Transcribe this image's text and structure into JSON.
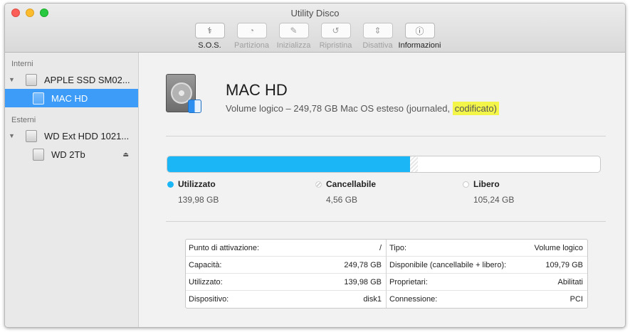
{
  "window": {
    "title": "Utility Disco"
  },
  "toolbar": {
    "items": [
      {
        "label": "S.O.S.",
        "icon": "stethoscope-icon",
        "glyph": "⚕",
        "enabled": true
      },
      {
        "label": "Partiziona",
        "icon": "partition-pie-icon",
        "glyph": "◔",
        "enabled": false
      },
      {
        "label": "Inizializza",
        "icon": "erase-icon",
        "glyph": "✎",
        "enabled": false
      },
      {
        "label": "Ripristina",
        "icon": "restore-icon",
        "glyph": "↺",
        "enabled": false
      },
      {
        "label": "Disattiva",
        "icon": "unmount-icon",
        "glyph": "⇕",
        "enabled": false
      },
      {
        "label": "Informazioni",
        "icon": "info-icon",
        "glyph": "ⓘ",
        "enabled": true
      }
    ]
  },
  "sidebar": {
    "sections": [
      {
        "header": "Interni",
        "disk": "APPLE SSD SM02...",
        "volume": "MAC HD"
      },
      {
        "header": "Esterni",
        "disk": "WD Ext HDD 1021...",
        "volume": "WD 2Tb"
      }
    ],
    "selected_volume": "MAC HD"
  },
  "volume": {
    "name": "MAC HD",
    "subtitle_prefix": "Volume logico – 249,78 GB Mac OS esteso (journaled,",
    "subtitle_highlight": "codificato)"
  },
  "usage": {
    "total_gb": 249.78,
    "used_gb": 139.98,
    "purgeable_gb": 4.56,
    "free_gb": 105.24,
    "colors": {
      "used": "#1bb6f6",
      "purgeable": "#e0e0e0",
      "free": "#ffffff"
    },
    "legend": [
      {
        "name": "Utilizzato",
        "value": "139,98 GB"
      },
      {
        "name": "Cancellabile",
        "value": "4,56 GB"
      },
      {
        "name": "Libero",
        "value": "105,24 GB"
      }
    ]
  },
  "info": {
    "left": [
      {
        "label": "Punto di attivazione:",
        "value": "/"
      },
      {
        "label": "Capacità:",
        "value": "249,78 GB"
      },
      {
        "label": "Utilizzato:",
        "value": "139,98 GB"
      },
      {
        "label": "Dispositivo:",
        "value": "disk1"
      }
    ],
    "right": [
      {
        "label": "Tipo:",
        "value": "Volume logico"
      },
      {
        "label": "Disponibile (cancellabile + libero):",
        "value": "109,79 GB"
      },
      {
        "label": "Proprietari:",
        "value": "Abilitati"
      },
      {
        "label": "Connessione:",
        "value": "PCI"
      }
    ]
  }
}
